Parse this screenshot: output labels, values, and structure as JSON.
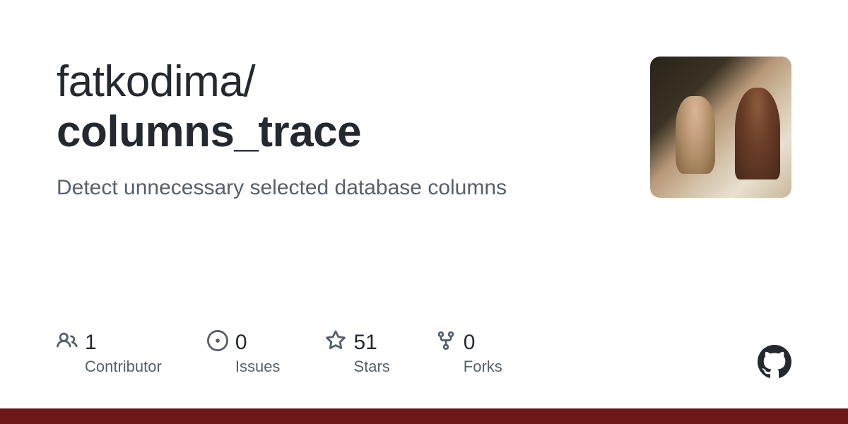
{
  "repo": {
    "owner": "fatkodima",
    "separator": "/",
    "name": "columns_trace",
    "description": "Detect unnecessary selected database columns"
  },
  "stats": {
    "contributors": {
      "value": "1",
      "label": "Contributor"
    },
    "issues": {
      "value": "0",
      "label": "Issues"
    },
    "stars": {
      "value": "51",
      "label": "Stars"
    },
    "forks": {
      "value": "0",
      "label": "Forks"
    }
  },
  "colors": {
    "accent_bar": "#6d1818"
  }
}
